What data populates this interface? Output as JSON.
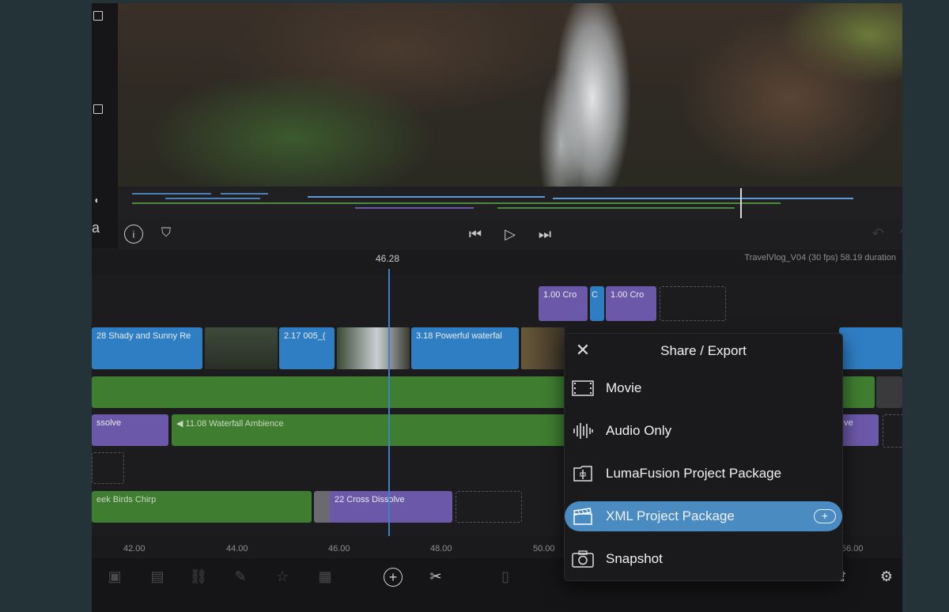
{
  "timecode": "46.28",
  "project_info": "TravelVlog_V04 (30 fps)  58.19 duration",
  "transitions": [
    {
      "label": "1.00  Cro"
    },
    {
      "label": "C"
    },
    {
      "label": "1.00  Cro"
    }
  ],
  "primary_clips": [
    {
      "label": "28  Shady and Sunny Re"
    },
    {
      "label": "2.17  005_("
    },
    {
      "label": "3.18  Powerful waterfal"
    }
  ],
  "audio_clips": [
    {
      "label": "ssolve"
    },
    {
      "label": "11.08  Waterfall Ambience"
    },
    {
      "label": "ve"
    },
    {
      "label": "eek Birds Chirp"
    },
    {
      "label": "22  Cross Dissolve"
    }
  ],
  "ruler_ticks": [
    "42.00",
    "44.00",
    "46.00",
    "48.00",
    "50.00",
    "56.00"
  ],
  "popover": {
    "title": "Share / Export",
    "items": [
      {
        "label": "Movie",
        "icon": "film-icon"
      },
      {
        "label": "Audio Only",
        "icon": "waveform-icon"
      },
      {
        "label": "LumaFusion Project Package",
        "icon": "package-icon"
      },
      {
        "label": "XML Project Package",
        "icon": "clapper-icon",
        "selected": true
      },
      {
        "label": "Snapshot",
        "icon": "camera-icon"
      }
    ],
    "selected_color": "#4a8bc2"
  },
  "colors": {
    "video_clip": "#2f7ec4",
    "audio_clip": "#3f7d31",
    "transition": "#6c58a8",
    "playhead": "#3f7fc6"
  }
}
